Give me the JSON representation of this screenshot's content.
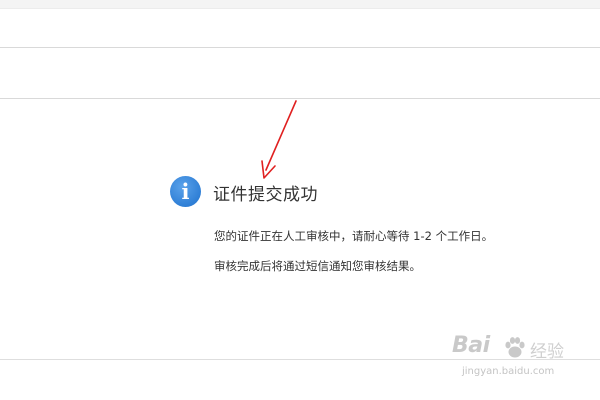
{
  "notice": {
    "icon": "info-icon",
    "icon_glyph": "i",
    "icon_color": "#2f7fd6",
    "title": "证件提交成功",
    "line1": "您的证件正在人工审核中，请耐心等待 1-2 个工作日。",
    "line2": "审核完成后将通过短信通知您审核结果。"
  },
  "annotation": {
    "icon": "red-arrow-icon",
    "color": "#e02020"
  },
  "watermark": {
    "logo_text": "Bai",
    "logo_suffix": "经验",
    "url": "jingyan.baidu.com"
  }
}
